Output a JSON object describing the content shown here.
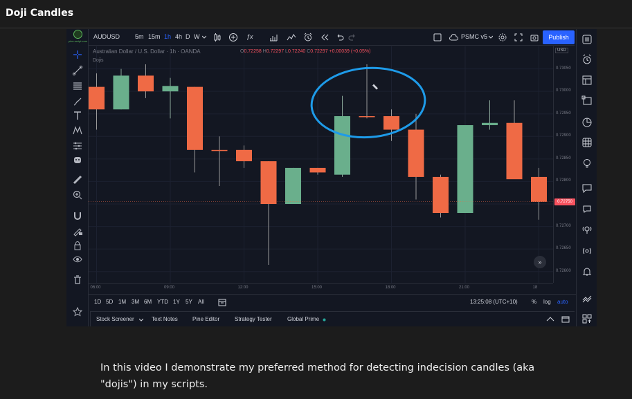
{
  "page": {
    "title": "Doji Candles",
    "caption": "In this video I demonstrate my preferred method for detecting indecision candles (aka \"dojis\") in my scripts."
  },
  "logo": {
    "text": "pine-script.com"
  },
  "toolbar": {
    "symbol": "AUDUSD",
    "intervals": [
      "5m",
      "15m",
      "1h",
      "4h",
      "D",
      "W"
    ],
    "active_interval": "1h",
    "indicators_icon": "fx-icon",
    "strategy_label": "PSMC v5",
    "publish_label": "Publish"
  },
  "legend": {
    "instrument": "Australian Dollar / U.S. Dollar · 1h · OANDA",
    "open_key": "O",
    "open": "0.72258",
    "high_key": "H",
    "high": "0.72297",
    "low_key": "L",
    "low": "0.72240",
    "close_key": "C",
    "close": "0.72297",
    "change": "+0.00039 (+0.05%)",
    "indicator": "Dojis"
  },
  "price_axis": {
    "currency": "USD",
    "current": "0.72750"
  },
  "chart_data": {
    "type": "candlestick",
    "y_ticks": [
      0.726,
      0.7265,
      0.727,
      0.7275,
      0.728,
      0.7285,
      0.729,
      0.7295,
      0.73,
      0.7305
    ],
    "y_tick_labels": [
      "0.72600",
      "0.72650",
      "0.72700",
      "0.72750",
      "0.72800",
      "0.72850",
      "0.72900",
      "0.72950",
      "0.73000",
      "0.73050"
    ],
    "ylim": [
      0.72575,
      0.731
    ],
    "x_labels": [
      "06:00",
      "09:00",
      "12:00",
      "15:00",
      "18:00",
      "21:00",
      "18"
    ],
    "x_label_index": [
      0,
      3,
      6,
      9,
      12,
      15,
      18
    ],
    "candles": [
      {
        "o": 0.7301,
        "h": 0.7304,
        "l": 0.72915,
        "c": 0.7296
      },
      {
        "o": 0.7296,
        "h": 0.7305,
        "l": 0.7296,
        "c": 0.73035
      },
      {
        "o": 0.73035,
        "h": 0.7306,
        "l": 0.72985,
        "c": 0.73
      },
      {
        "o": 0.73,
        "h": 0.7303,
        "l": 0.7294,
        "c": 0.73012
      },
      {
        "o": 0.7301,
        "h": 0.7301,
        "l": 0.7282,
        "c": 0.7287
      },
      {
        "o": 0.7287,
        "h": 0.729,
        "l": 0.7279,
        "c": 0.7287
      },
      {
        "o": 0.7287,
        "h": 0.7288,
        "l": 0.7283,
        "c": 0.72845
      },
      {
        "o": 0.72845,
        "h": 0.72845,
        "l": 0.72615,
        "c": 0.7275
      },
      {
        "o": 0.7275,
        "h": 0.7283,
        "l": 0.7275,
        "c": 0.7283
      },
      {
        "o": 0.7283,
        "h": 0.7283,
        "l": 0.72815,
        "c": 0.7282
      },
      {
        "o": 0.72815,
        "h": 0.7299,
        "l": 0.7281,
        "c": 0.72945
      },
      {
        "o": 0.72945,
        "h": 0.7306,
        "l": 0.7294,
        "c": 0.72945
      },
      {
        "o": 0.72945,
        "h": 0.7296,
        "l": 0.7289,
        "c": 0.72915
      },
      {
        "o": 0.72915,
        "h": 0.7295,
        "l": 0.7276,
        "c": 0.7281
      },
      {
        "o": 0.7281,
        "h": 0.72815,
        "l": 0.7272,
        "c": 0.7273
      },
      {
        "o": 0.7273,
        "h": 0.72925,
        "l": 0.7273,
        "c": 0.72925
      },
      {
        "o": 0.72925,
        "h": 0.7298,
        "l": 0.72915,
        "c": 0.7293
      },
      {
        "o": 0.7293,
        "h": 0.7298,
        "l": 0.7281,
        "c": 0.72805
      },
      {
        "o": 0.7281,
        "h": 0.7283,
        "l": 0.72715,
        "c": 0.72755
      }
    ],
    "up_color": "#6aaf8c",
    "down_color": "#ef6a45",
    "annotation": "blue ellipse drawn around doji candle"
  },
  "range": {
    "items": [
      "1D",
      "5D",
      "1M",
      "3M",
      "6M",
      "YTD",
      "1Y",
      "5Y",
      "All"
    ],
    "clock": "13:25:08 (UTC+10)",
    "percent": "%",
    "log": "log",
    "auto": "auto"
  },
  "bottom_tabs": [
    "Stock Screener",
    "Text Notes",
    "Pine Editor",
    "Strategy Tester",
    "Global Prime"
  ],
  "colors": {
    "accent": "#2962ff",
    "bg": "#131722",
    "annotation": "#1e9be9"
  }
}
